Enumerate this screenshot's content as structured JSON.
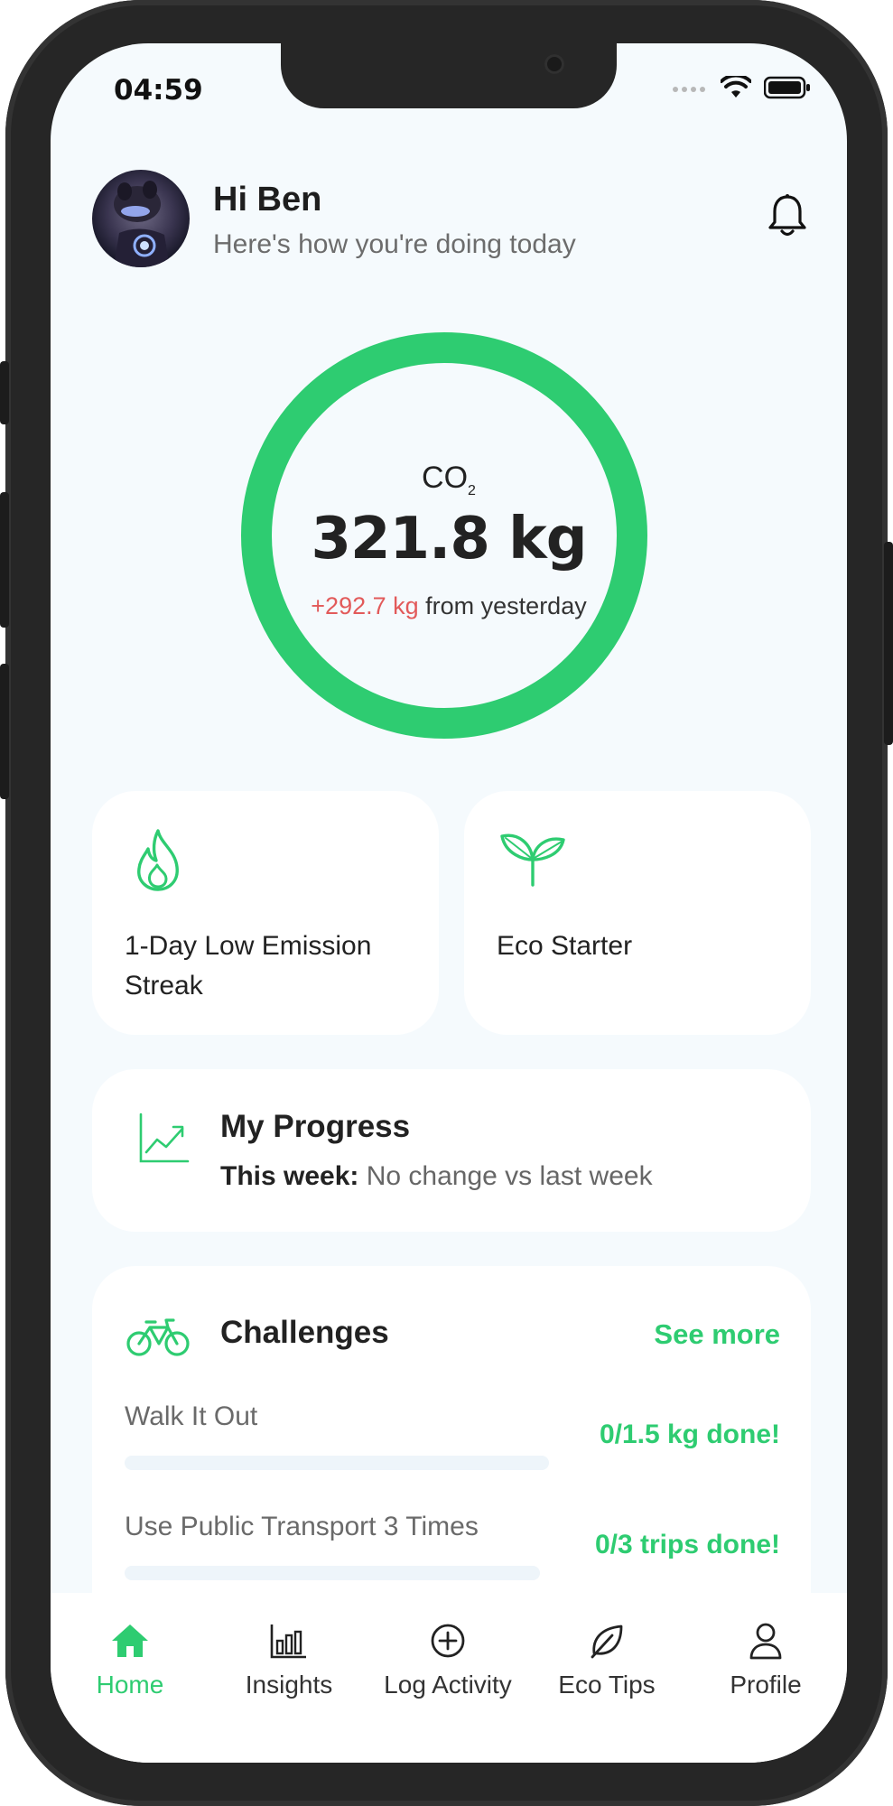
{
  "status_bar": {
    "time": "04:59"
  },
  "header": {
    "greeting": "Hi Ben",
    "subtitle": "Here's how you're doing today"
  },
  "emissions": {
    "label": "CO",
    "label_subscript": "2",
    "value": "321.8 kg",
    "delta": "+292.7 kg",
    "delta_suffix": "from yesterday"
  },
  "badges": [
    {
      "icon": "flame-icon",
      "line1": "1-Day Low Emission",
      "line2": "Streak"
    },
    {
      "icon": "sprout-icon",
      "line1": "Eco Starter"
    }
  ],
  "progress": {
    "title": "My Progress",
    "label": "This week:",
    "text": "No change vs last week"
  },
  "challenges": {
    "title": "Challenges",
    "see_more": "See more",
    "items": [
      {
        "name": "Walk It Out",
        "status": "0/1.5 kg done!",
        "progress": 0
      },
      {
        "name": "Use Public Transport 3 Times",
        "status": "0/3 trips done!",
        "progress": 0
      }
    ]
  },
  "nav": [
    {
      "label": "Home",
      "icon": "home-icon",
      "active": true
    },
    {
      "label": "Insights",
      "icon": "bar-chart-icon"
    },
    {
      "label": "Log Activity",
      "icon": "plus-circle-icon"
    },
    {
      "label": "Eco Tips",
      "icon": "leaf-icon"
    },
    {
      "label": "Profile",
      "icon": "user-icon"
    }
  ],
  "colors": {
    "accent": "#2ecc71",
    "delta_red": "#e25a5a",
    "background": "#f5fafd",
    "frame": "#262626"
  }
}
